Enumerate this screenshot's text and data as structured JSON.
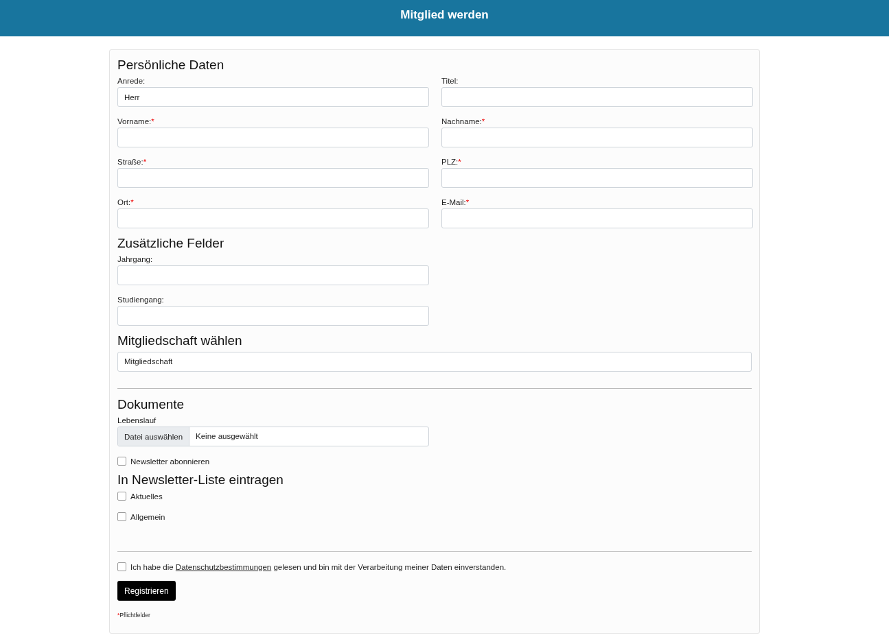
{
  "header": {
    "title": "Mitglied werden"
  },
  "personal": {
    "title": "Persönliche Daten",
    "fields": [
      {
        "label": "Anrede:",
        "value": "Herr"
      },
      {
        "label": "Titel:"
      },
      {
        "label": "Vorname:",
        "required_mark": "*"
      },
      {
        "label": "Nachname:",
        "required_mark": "*"
      },
      {
        "label": "Straße:",
        "required_mark": "*"
      },
      {
        "label": "PLZ:",
        "required_mark": "*"
      },
      {
        "label": "Ort:",
        "required_mark": "*"
      },
      {
        "label": "E-Mail:",
        "required_mark": "*"
      }
    ]
  },
  "additional": {
    "title": "Zusätzliche Felder",
    "fields": [
      {
        "label": "Jahrgang:"
      },
      {
        "label": "Studiengang:"
      }
    ]
  },
  "membership": {
    "title": "Mitgliedschaft wählen",
    "select": {
      "value": "Mitgliedschaft"
    }
  },
  "documents": {
    "title": "Dokumente",
    "file": {
      "label": "Lebenslauf",
      "button": "Datei auswählen",
      "status": "Keine ausgewählt"
    },
    "newsletter": {
      "label": "Newsletter abonnieren",
      "checked": false
    }
  },
  "newsletter_lists": {
    "title": "In Newsletter-Liste eintragen",
    "options": [
      {
        "label": "Aktuelles",
        "checked": false
      },
      {
        "label": "Allgemein",
        "checked": false
      }
    ]
  },
  "consent": {
    "checked": false,
    "before": "Ich habe die",
    "link": "Datenschutzbestimmungen",
    "after": "gelesen und bin mit der Verarbeitung meiner Daten einverstanden."
  },
  "submit": {
    "label": "Registrieren"
  },
  "footnote": {
    "mark": "*",
    "text": "Pflichtfelder"
  }
}
